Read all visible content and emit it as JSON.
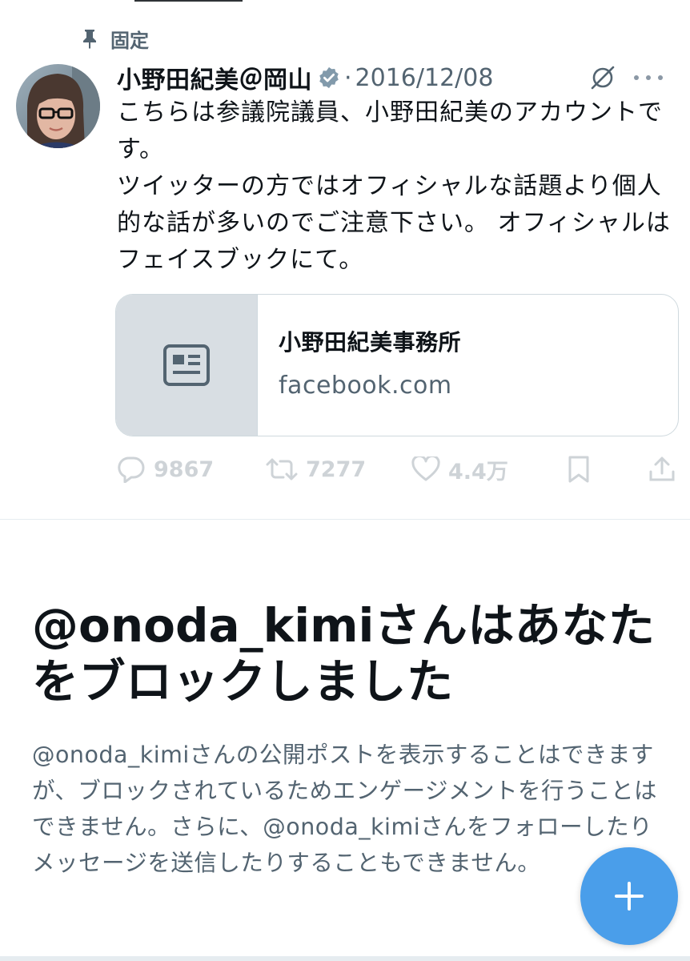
{
  "pinned": {
    "label": "固定",
    "icon": "pin-icon"
  },
  "tweet": {
    "display_name": "小野田紀美＠岡山",
    "separator": "·",
    "date": "2016/12/08",
    "verified_icon": "verified-badge-icon",
    "text_line1": "こちらは参議院議員、小野田紀美のアカウントです。",
    "text_line2": "ツイッターの方ではオフィシャルな話題より個人的な話が多いのでご注意下さい。 オフィシャルはフェイスブックにて。",
    "link_card": {
      "title": "小野田紀美事務所",
      "domain": "facebook.com",
      "thumbnail_icon": "article-icon"
    },
    "actions": {
      "replies": "9867",
      "reposts": "7277",
      "likes": "4.4万"
    }
  },
  "block_notice": {
    "handle": "@onoda_kimi",
    "heading_rest": "さんはあなたをブロックしました",
    "desc_handle_1": "@onoda_kimi",
    "desc_part1": "さんの公開ポストを表示することはできますが、ブロックされているためエンゲージメントを行うことはできません。さらに、",
    "desc_handle_2": "@onoda_kimi",
    "desc_part2": "さんをフォローしたりメッセージを送信したりすることもできません。"
  },
  "fab": {
    "icon": "plus-icon",
    "color": "#4a9eea"
  },
  "colors": {
    "text": "#0f1419",
    "secondary": "#536471",
    "accent": "#1d9bf0",
    "border": "#cfd9de"
  }
}
